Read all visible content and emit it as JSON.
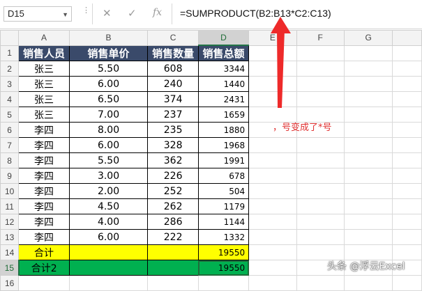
{
  "formula_bar": {
    "name_box": "D15",
    "cancel_glyph": "✕",
    "enter_glyph": "✓",
    "fx_glyph": "fx",
    "formula": "=SUMPRODUCT(B2:B13*C2:C13)"
  },
  "columns": [
    "A",
    "B",
    "C",
    "D",
    "E",
    "F",
    "G"
  ],
  "rows": [
    {
      "n": "1",
      "a": "销售人员",
      "b": "销售单价",
      "c": "销售数量",
      "d": "销售总额"
    },
    {
      "n": "2",
      "a": "张三",
      "b": "5.50",
      "c": "608",
      "d": "3344"
    },
    {
      "n": "3",
      "a": "张三",
      "b": "6.00",
      "c": "240",
      "d": "1440"
    },
    {
      "n": "4",
      "a": "张三",
      "b": "6.50",
      "c": "374",
      "d": "2431"
    },
    {
      "n": "5",
      "a": "张三",
      "b": "7.00",
      "c": "237",
      "d": "1659"
    },
    {
      "n": "6",
      "a": "李四",
      "b": "8.00",
      "c": "235",
      "d": "1880"
    },
    {
      "n": "7",
      "a": "李四",
      "b": "6.00",
      "c": "328",
      "d": "1968"
    },
    {
      "n": "8",
      "a": "李四",
      "b": "5.50",
      "c": "362",
      "d": "1991"
    },
    {
      "n": "9",
      "a": "李四",
      "b": "3.00",
      "c": "226",
      "d": "678"
    },
    {
      "n": "10",
      "a": "李四",
      "b": "2.00",
      "c": "252",
      "d": "504"
    },
    {
      "n": "11",
      "a": "李四",
      "b": "4.50",
      "c": "262",
      "d": "1179"
    },
    {
      "n": "12",
      "a": "李四",
      "b": "4.00",
      "c": "286",
      "d": "1144"
    },
    {
      "n": "13",
      "a": "李四",
      "b": "6.00",
      "c": "222",
      "d": "1332"
    },
    {
      "n": "14",
      "a": "合计",
      "b": "",
      "c": "",
      "d": "19550"
    },
    {
      "n": "15",
      "a": "合计2",
      "b": "",
      "c": "",
      "d": "19550"
    },
    {
      "n": "16",
      "a": "",
      "b": "",
      "c": "",
      "d": ""
    }
  ],
  "annotation": "，号变成了*号",
  "watermark": "头条 @浮云Excel",
  "colors": {
    "header_fill": "#3a4a6a",
    "total_fill": "#ffff00",
    "total2_fill": "#00b050",
    "annotation": "#e03030"
  }
}
